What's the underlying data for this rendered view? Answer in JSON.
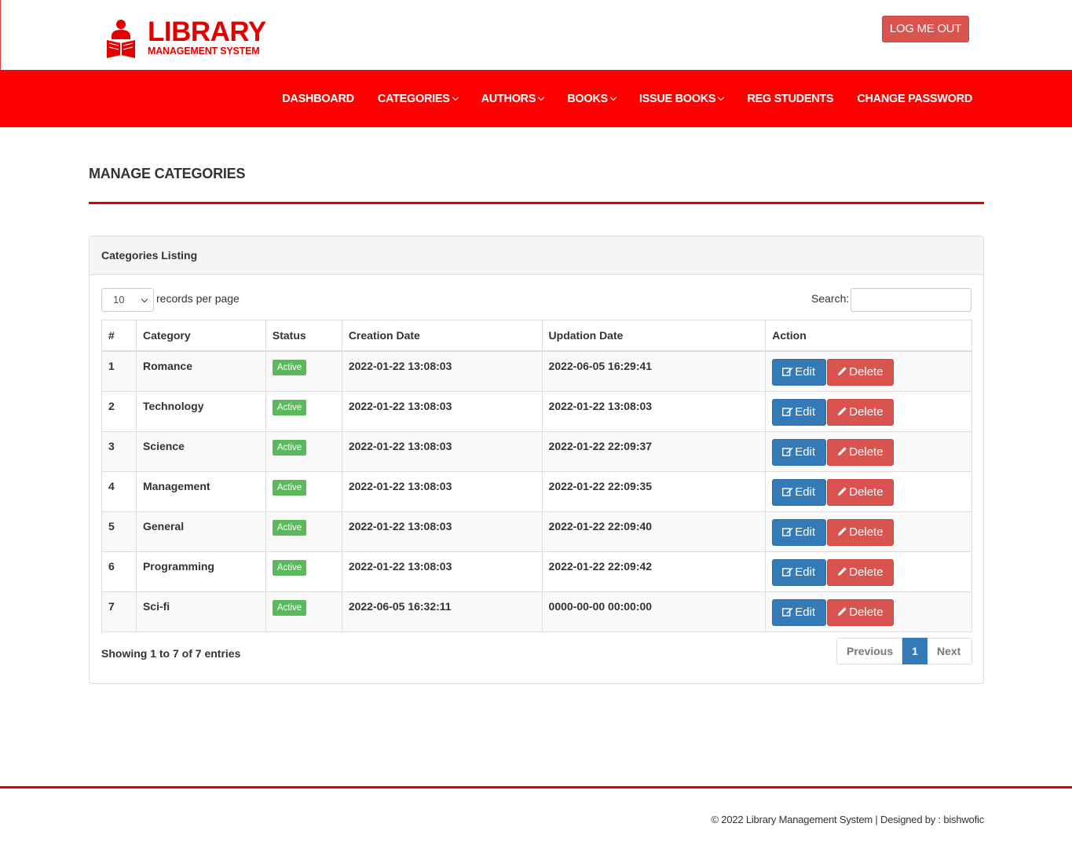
{
  "brand": {
    "title": "LIBRARY",
    "subtitle": "MANAGEMENT SYSTEM",
    "color": "#e50000"
  },
  "header": {
    "logout_label": "LOG ME OUT"
  },
  "nav": {
    "items": [
      {
        "label": "DASHBOARD",
        "dropdown": false
      },
      {
        "label": "CATEGORIES",
        "dropdown": true
      },
      {
        "label": "AUTHORS",
        "dropdown": true
      },
      {
        "label": "BOOKS",
        "dropdown": true
      },
      {
        "label": "ISSUE BOOKS",
        "dropdown": true
      },
      {
        "label": "REG STUDENTS",
        "dropdown": false
      },
      {
        "label": "CHANGE PASSWORD",
        "dropdown": false
      }
    ],
    "background": "#ff0000"
  },
  "page": {
    "title": "MANAGE CATEGORIES"
  },
  "panel": {
    "heading": "Categories Listing",
    "length_value": "10",
    "length_label": "records per page",
    "search_label": "Search:",
    "search_value": "",
    "columns": [
      "#",
      "Category",
      "Status",
      "Creation Date",
      "Updation Date",
      "Action"
    ],
    "rows": [
      {
        "num": "1",
        "category": "Romance",
        "status": "Active",
        "created": "2022-01-22 13:08:03",
        "updated": "2022-06-05 16:29:41"
      },
      {
        "num": "2",
        "category": "Technology",
        "status": "Active",
        "created": "2022-01-22 13:08:03",
        "updated": "2022-01-22 13:08:03"
      },
      {
        "num": "3",
        "category": "Science",
        "status": "Active",
        "created": "2022-01-22 13:08:03",
        "updated": "2022-01-22 22:09:37"
      },
      {
        "num": "4",
        "category": "Management",
        "status": "Active",
        "created": "2022-01-22 13:08:03",
        "updated": "2022-01-22 22:09:35"
      },
      {
        "num": "5",
        "category": "General",
        "status": "Active",
        "created": "2022-01-22 13:08:03",
        "updated": "2022-01-22 22:09:40"
      },
      {
        "num": "6",
        "category": "Programming",
        "status": "Active",
        "created": "2022-01-22 13:08:03",
        "updated": "2022-01-22 22:09:42"
      },
      {
        "num": "7",
        "category": "Sci-fi",
        "status": "Active",
        "created": "2022-06-05 16:32:11",
        "updated": "0000-00-00 00:00:00"
      }
    ],
    "edit_label": "Edit",
    "delete_label": "Delete",
    "info": "Showing 1 to 7 of 7 entries",
    "pager": {
      "prev": "Previous",
      "current": "1",
      "next": "Next"
    }
  },
  "footer": {
    "text": "© 2022 Library Management System | Designed by : bishwofic"
  }
}
